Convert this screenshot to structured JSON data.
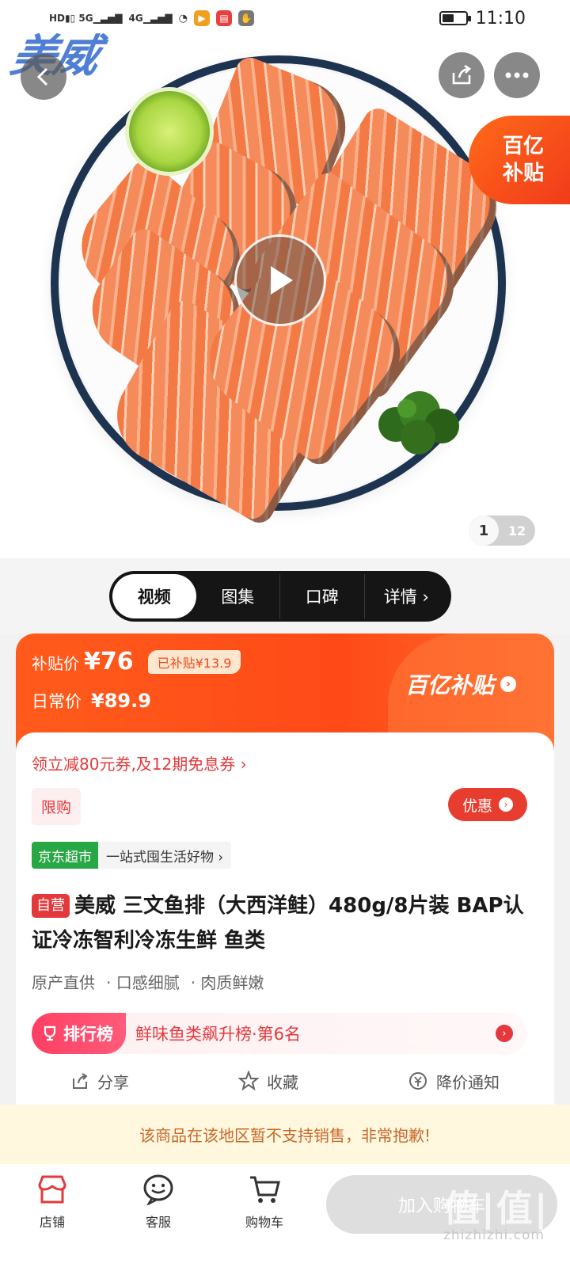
{
  "status_bar": {
    "left": "HD 5G 4G",
    "time": "11:10"
  },
  "hero": {
    "brand_logo": "美威",
    "subsidy_corner": [
      "百亿",
      "补贴"
    ],
    "page_current": "1",
    "page_total": "12"
  },
  "media_tabs": [
    {
      "label": "视频",
      "active": true
    },
    {
      "label": "图集"
    },
    {
      "label": "口碑"
    },
    {
      "label": "详情 ›"
    }
  ],
  "price": {
    "subsidy_label": "补贴价",
    "subsidy_price": "¥76",
    "saved": "已补贴¥13.9",
    "regular_label": "日常价",
    "regular_price": "¥89.9",
    "brand": "百亿补贴"
  },
  "info": {
    "coupon": "领立减80元券,及12期免息券 ›",
    "limit_tag": "限购",
    "promo_button": "优惠",
    "store_name": "京东超市",
    "store_slogan": "一站式囤生活好物 ›",
    "self_operated": "自营",
    "title": "美威 三文鱼排（大西洋鲑）480g/8片装 BAP认证冷冻智利冷冻生鲜 鱼类",
    "features": [
      "原产直供",
      "· 口感细腻",
      "· 肉质鲜嫩"
    ],
    "rank_badge": "排行榜",
    "rank_text": "鲜味鱼类飙升榜·第6名",
    "actions": {
      "share": "分享",
      "favorite": "收藏",
      "price_alert": "降价通知"
    }
  },
  "notice": "该商品在该地区暂不支持销售，非常抱歉!",
  "bottom_bar": {
    "store": "店铺",
    "service": "客服",
    "cart": "购物车",
    "add_cart": "加入购物车",
    "watermark": "值|值|值",
    "watermark_url": "zhizhizhi.com"
  },
  "colors": {
    "accent_red": "#e4393c",
    "subsidy_orange": "#ff4a17",
    "store_green": "#28a745"
  }
}
